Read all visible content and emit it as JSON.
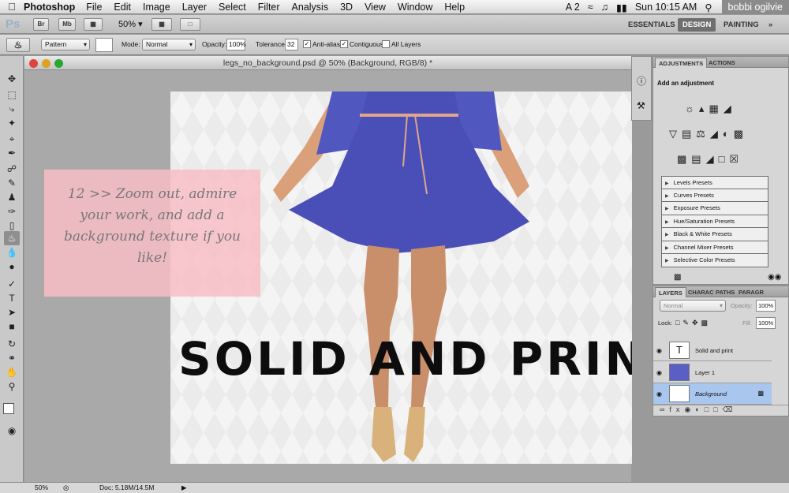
{
  "menubar": {
    "app_name": "Photoshop",
    "items": [
      "File",
      "Edit",
      "Image",
      "Layer",
      "Select",
      "Filter",
      "Analysis",
      "3D",
      "View",
      "Window",
      "Help"
    ],
    "status_icons": "A 2",
    "clock": "Sun 10:15 AM",
    "user": "bobbi ogilvie"
  },
  "appbar": {
    "logo": "Ps",
    "bridge": "Br",
    "minibridge": "Mb",
    "zoom": "50%",
    "workspaces": [
      "ESSENTIALS",
      "DESIGN",
      "PAINTING"
    ],
    "active_workspace": "DESIGN",
    "more": "»"
  },
  "options": {
    "fill_source": "Pattern",
    "mode_label": "Mode:",
    "mode_value": "Normal",
    "opacity_label": "Opacity:",
    "opacity_value": "100%",
    "tolerance_label": "Tolerance:",
    "tolerance_value": "32",
    "antialias_label": "Anti-alias",
    "contiguous_label": "Contiguous",
    "all_layers_label": "All Layers"
  },
  "document": {
    "title": "legs_no_background.psd @ 50% (Background, RGB/8) *",
    "headline": "SOLID AND PRINT",
    "note": "12 >> Zoom out, admire your work, and add a background texture if you like!"
  },
  "status": {
    "zoom": "50%",
    "doc_size": "Doc: 5.18M/14.5M"
  },
  "adjustments": {
    "tabs": [
      "ADJUSTMENTS",
      "ACTIONS"
    ],
    "heading": "Add an adjustment",
    "presets": [
      "Levels Presets",
      "Curves Presets",
      "Exposure Presets",
      "Hue/Saturation Presets",
      "Black & White Presets",
      "Channel Mixer Presets",
      "Selective Color Presets"
    ]
  },
  "layers": {
    "tabs": [
      "LAYERS",
      "CHARAC",
      "PATHS",
      "PARAGR"
    ],
    "blend_mode": "Normal",
    "opacity_label": "Opacity:",
    "opacity_value": "100%",
    "lock_label": "Lock:",
    "fill_label": "Fill:",
    "fill_value": "100%",
    "items": [
      {
        "name": "Solid and print"
      },
      {
        "name": "Layer 1"
      },
      {
        "name": "Background"
      }
    ],
    "text_thumb": "T"
  },
  "colors": {
    "selected_layer": "#a9c6ef",
    "note_bg": "#f8bec6",
    "dress": "#4a4fb8"
  }
}
